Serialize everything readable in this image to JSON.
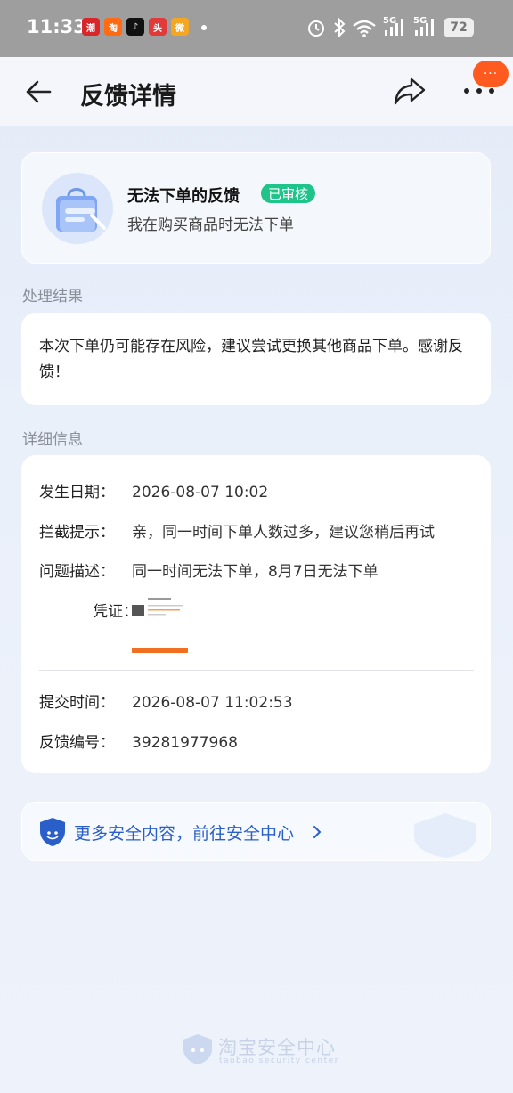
{
  "status_bar": {
    "time": "11:33",
    "apps": [
      {
        "name": "weibo-like-app",
        "label": "潮",
        "color": "#d8262b"
      },
      {
        "name": "taobao-app",
        "label": "淘",
        "color": "#ff6a13"
      },
      {
        "name": "tiktok-app",
        "label": "♪",
        "color": "#111111"
      },
      {
        "name": "news-app",
        "label": "头",
        "color": "#e03a3a"
      },
      {
        "name": "weibo-app",
        "label": "微",
        "color": "#f5a623"
      }
    ],
    "battery": "72",
    "signal_labels": [
      "5G",
      "5G"
    ]
  },
  "header": {
    "title": "反馈详情",
    "badge_dots": "···"
  },
  "summary": {
    "title": "无法下单的反馈",
    "status": "已审核",
    "subtitle": "我在购买商品时无法下单"
  },
  "result_section": {
    "label": "处理结果",
    "text": "本次下单仍可能存在风险，建议尝试更换其他商品下单。感谢反馈！"
  },
  "detail_section": {
    "label": "详细信息",
    "rows": [
      {
        "label": "发生日期：",
        "value": "2026-08-07 10:02"
      },
      {
        "label": "拦截提示：",
        "value": "亲，同一时间下单人数过多，建议您稍后再试"
      },
      {
        "label": "问题描述：",
        "value": "同一时间无法下单，8月7日无法下单"
      }
    ],
    "evidence_label": "凭证：",
    "meta_rows": [
      {
        "label": "提交时间：",
        "value": "2026-08-07 11:02:53"
      },
      {
        "label": "反馈编号：",
        "value": "39281977968"
      }
    ]
  },
  "security": {
    "text": "更多安全内容，前往安全中心",
    "chevron": "›"
  },
  "footer": {
    "name": "淘宝安全中心",
    "en": "taobao security center"
  },
  "colors": {
    "accent_blue": "#2a5fc9",
    "status_green": "#1fc48b",
    "badge_orange": "#ff5a1f"
  }
}
